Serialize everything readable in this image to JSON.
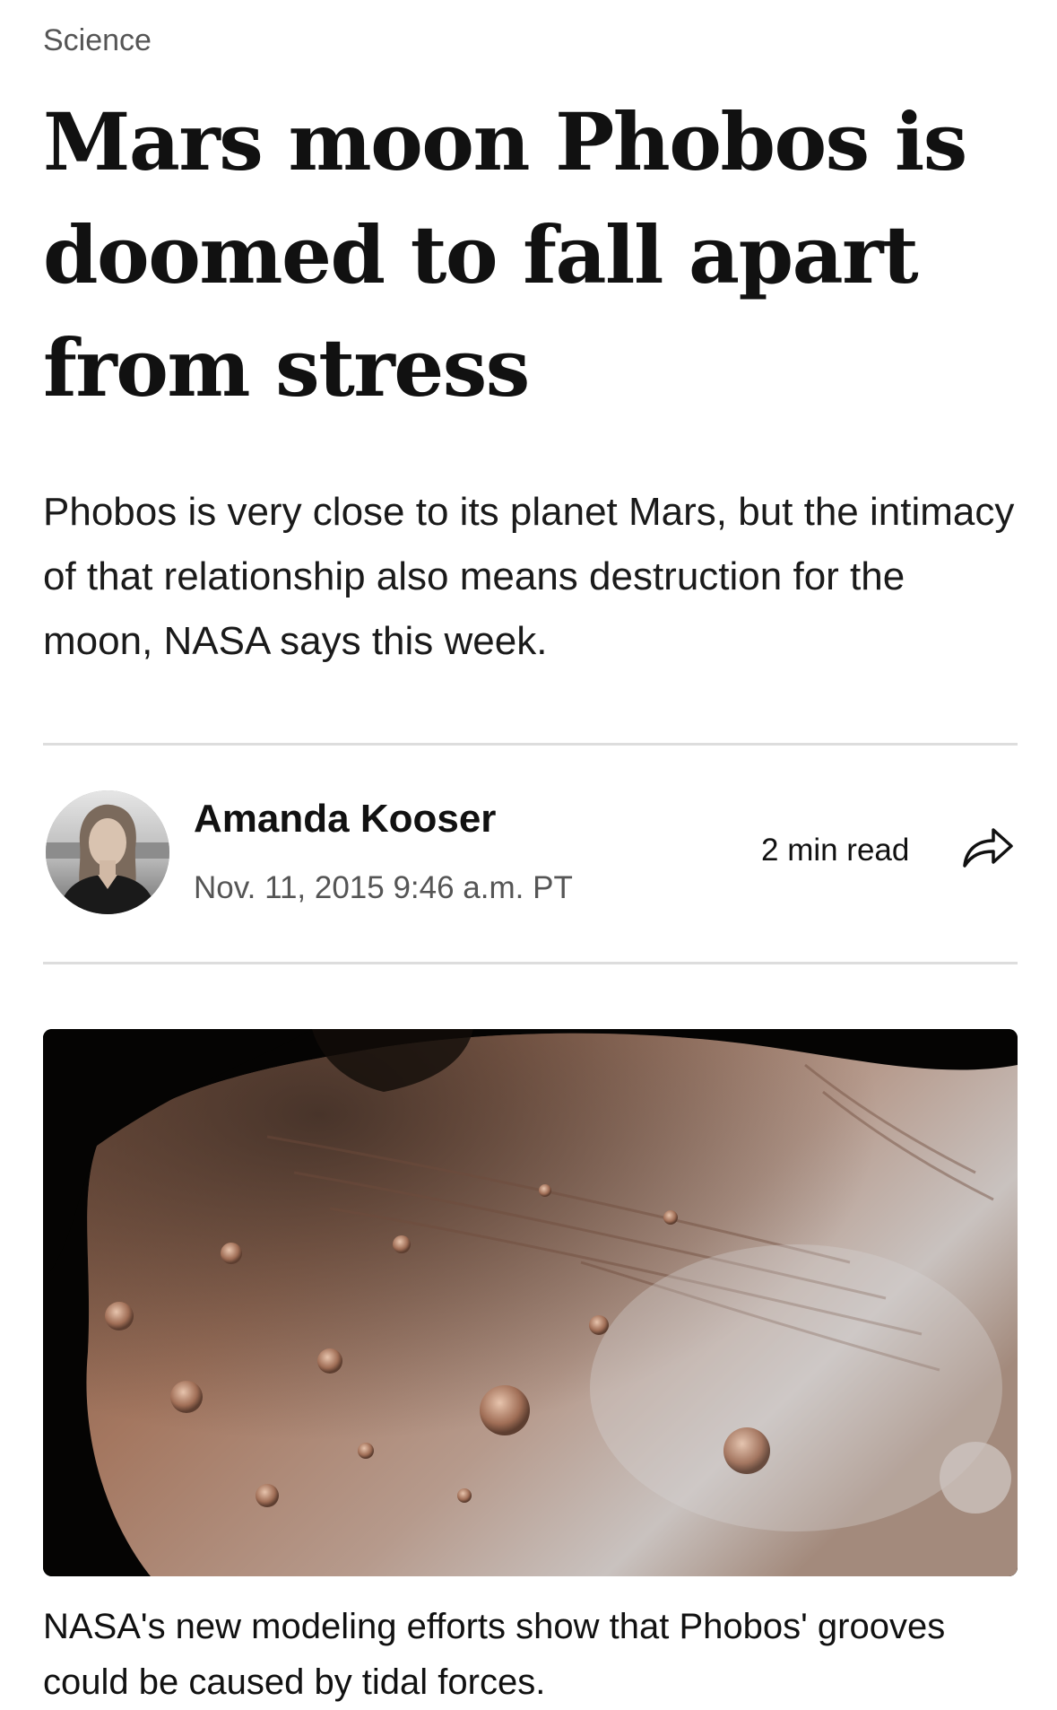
{
  "article": {
    "category": "Science",
    "headline": "Mars moon Phobos is doomed to fall apart from stress",
    "dek": "Phobos is very close to its planet Mars, but the intimacy of that relationship also means destruction for the moon, NASA says this week.",
    "author": {
      "name": "Amanda Kooser",
      "date": "Nov. 11, 2015 9:46 a.m. PT"
    },
    "read_time": "2 min read",
    "hero_image_caption": "NASA's new modeling efforts show that Phobos' grooves could be caused by tidal forces."
  },
  "icons": {
    "share": "share-arrow-icon"
  },
  "colors": {
    "text": "#111111",
    "muted": "#555555",
    "divider": "#dddddd"
  }
}
